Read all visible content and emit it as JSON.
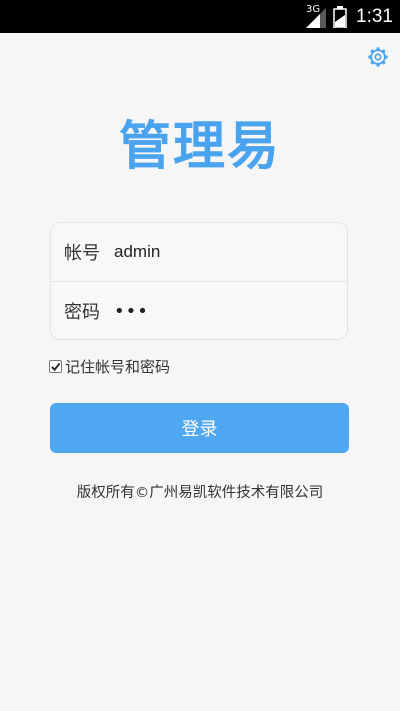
{
  "status_bar": {
    "network": "3G",
    "time": "1:31"
  },
  "icons": {
    "settings": "gear-icon",
    "signal": "signal-icon",
    "battery": "battery-icon"
  },
  "app": {
    "title": "管理易"
  },
  "login": {
    "username_label": "帐号",
    "username_value": "admin",
    "password_label": "密码",
    "password_value": "•••",
    "remember_label": "记住帐号和密码",
    "remember_checked": true,
    "submit_label": "登录"
  },
  "footer": {
    "copyright": "版权所有©广州易凯软件技术有限公司"
  },
  "colors": {
    "accent": "#4fa7f2",
    "title": "#4aa3ef",
    "background": "#f6f6f6"
  }
}
